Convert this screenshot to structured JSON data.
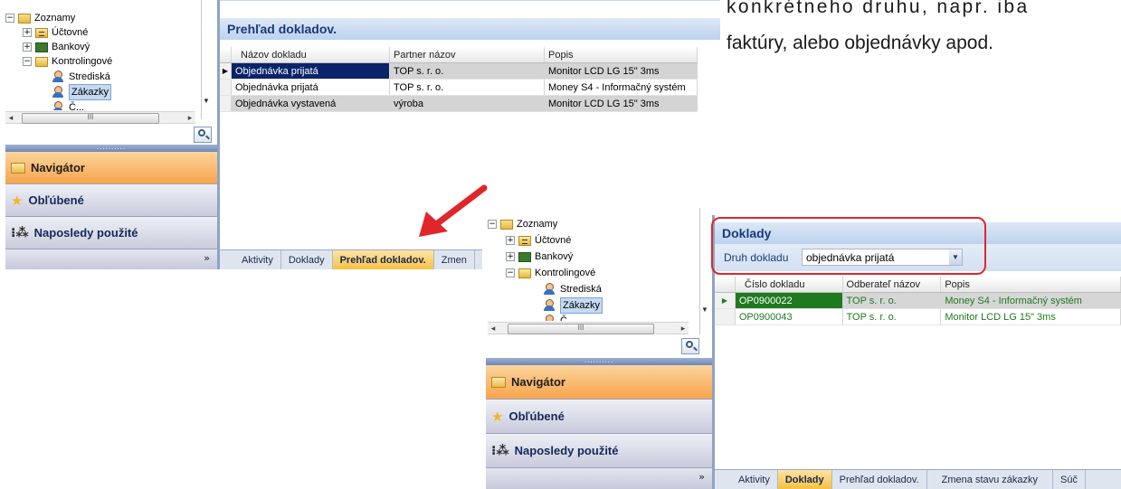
{
  "paragraph": {
    "line1": "konkrétneho druhu, napr. iba",
    "line2": "faktúry, alebo objednávky apod."
  },
  "tree": {
    "items": [
      {
        "label": "Zoznamy",
        "expander": "⊟",
        "icon": "folder-icon"
      },
      {
        "label": "Účtovné",
        "expander": "⊞",
        "icon": "accounting-folder-icon"
      },
      {
        "label": "Bankový",
        "expander": "⊞",
        "icon": "bank-folder-icon"
      },
      {
        "label": "Kontrolingové",
        "expander": "⊟",
        "icon": "control-folder-icon"
      },
      {
        "label": "Strediská",
        "icon": "person-icon"
      },
      {
        "label": "Zákazky",
        "icon": "person-icon",
        "selected": true
      },
      {
        "label": "Č...",
        "icon": "person-icon"
      }
    ],
    "scroll_grip": "III"
  },
  "nav": {
    "grip": "..........",
    "buttons": [
      {
        "label": "Navigátor",
        "icon": "folder-icon",
        "active": true
      },
      {
        "label": "Obľúbené",
        "icon": "star-icon"
      },
      {
        "label": "Naposledy použité",
        "icon": "recent-icon"
      }
    ],
    "footer_chevron": "»"
  },
  "panel1": {
    "title": "Prehľad dokladov.",
    "columns": [
      "Názov dokladu",
      "Partner názov",
      "Popis"
    ],
    "rows": [
      [
        "Objednávka prijatá",
        "TOP s. r. o.",
        "Monitor LCD LG 15\" 3ms"
      ],
      [
        "Objednávka prijatá",
        "TOP s. r. o.",
        "Money S4 - Informačný systém"
      ],
      [
        "Objednávka vystavená",
        "výroba",
        "Monitor LCD LG 15\" 3ms"
      ]
    ],
    "tabs": [
      "Aktivity",
      "Doklady",
      "Prehľad dokladov.",
      "Zmen"
    ],
    "active_tab": 2
  },
  "panel2": {
    "title": "Doklady",
    "filter_label": "Druh dokladu",
    "filter_value": "objednávka prijatá",
    "columns": [
      "Číslo dokladu",
      "Odberateľ názov",
      "Popis"
    ],
    "rows": [
      [
        "OP0900022",
        "TOP s. r. o.",
        "Money S4 - Informačný systém"
      ],
      [
        "OP0900043",
        "TOP s. r. o.",
        "Monitor LCD LG 15\" 3ms"
      ]
    ],
    "tabs": [
      "Aktivity",
      "Doklady",
      "Prehľad dokladov.",
      "Zmena stavu zákazky",
      "Súč"
    ],
    "active_tab": 1
  },
  "colors": {
    "accent_orange": "#f8a44d",
    "selected_row_green": "#1f7a1f",
    "highlight_red": "#e0262a",
    "arrow_red": "#e0262a"
  }
}
